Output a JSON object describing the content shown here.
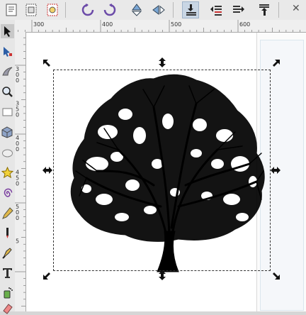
{
  "toolbar": {
    "buttons": [
      "document-properties-icon",
      "xml-editor-icon",
      "import-export-icon",
      "rotate-ccw-icon",
      "rotate-cw-icon",
      "flip-vertical-icon",
      "flip-horizontal-icon",
      "raise-to-top-icon",
      "raise-icon",
      "lower-icon",
      "lower-to-bottom-icon"
    ],
    "close_label": "✕"
  },
  "ruler": {
    "top_labels": [
      "300",
      "400",
      "500",
      "600"
    ],
    "left_labels": [
      "3",
      "0",
      "0",
      "3",
      "5",
      "0",
      "4",
      "0",
      "0",
      "4",
      "5",
      "0",
      "5",
      "0",
      "0",
      "5"
    ]
  },
  "tools": [
    "selector-tool-icon",
    "node-tool-icon",
    "tweak-tool-icon",
    "zoom-tool-icon",
    "rectangle-tool-icon",
    "3d-box-tool-icon",
    "ellipse-tool-icon",
    "star-tool-icon",
    "spiral-tool-icon",
    "pencil-tool-icon",
    "pen-tool-icon",
    "calligraphy-tool-icon",
    "text-tool-icon",
    "spray-tool-icon",
    "eraser-tool-icon"
  ],
  "colors": {
    "selection_dash": "#333333",
    "tree_fill": "#000000",
    "canvas": "#ffffff"
  }
}
